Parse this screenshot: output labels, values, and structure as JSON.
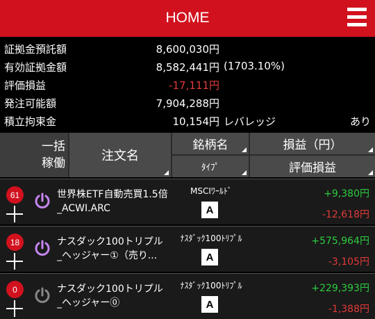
{
  "header": {
    "title": "HOME"
  },
  "summary": [
    {
      "label": "証拠金預託額",
      "value": "8,600,030円",
      "negative": false
    },
    {
      "label": "有効証拠金額",
      "value": "8,582,441円",
      "extra": "(1703.10%)",
      "negative": false
    },
    {
      "label": "評価損益",
      "value": "-17,111円",
      "negative": true
    },
    {
      "label": "発注可能額",
      "value": "7,904,288円",
      "negative": false
    },
    {
      "label": "積立拘束金",
      "value": "10,154円",
      "extra": "レバレッジ",
      "extra_right": "あり",
      "negative": false
    }
  ],
  "table_header": {
    "ikkatsu_line1": "一括",
    "ikkatsu_line2": "稼働",
    "order_name": "注文名",
    "symbol": "銘柄名",
    "type": "ﾀｲﾌﾟ",
    "pl": "損益（円）",
    "valuation": "評価損益"
  },
  "rows": [
    {
      "count": "61",
      "name_line1": "世界株ETF自動売買1.5倍",
      "name_line2": "_ACWI.ARC",
      "symbol": "MSCIﾜｰﾙﾄﾞ",
      "type": "A",
      "pl": "+9,380円",
      "valuation": "-12,618円",
      "power_color": "#c586f0",
      "power_on": true
    },
    {
      "count": "18",
      "name_line1": "ナスダック100トリプル",
      "name_line2": "_ヘッジャー①（売り...",
      "symbol": "ﾅｽﾀﾞｯｸ100ﾄﾘﾌﾟﾙ",
      "type": "A",
      "pl": "+575,964円",
      "valuation": "-3,105円",
      "power_color": "#c586f0",
      "power_on": true
    },
    {
      "count": "0",
      "name_line1": "ナスダック100トリプル",
      "name_line2": "_ヘッジャー⓪",
      "symbol": "ﾅｽﾀﾞｯｸ100ﾄﾘﾌﾟﾙ",
      "type": "A",
      "pl": "+229,393円",
      "valuation": "-1,388円",
      "power_color": "#888888",
      "power_on": false
    }
  ]
}
